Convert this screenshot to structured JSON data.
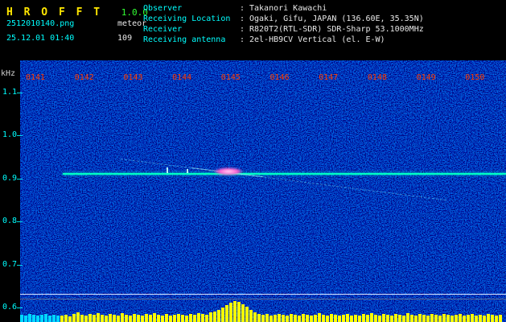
{
  "app": {
    "title": "H R O F F T",
    "version": "1.0.0",
    "filename": "2512010140.png",
    "mode_label": "meteor",
    "timestamp": "25.12.01 01:40",
    "echo_count": "109"
  },
  "station_info": {
    "separator": ":",
    "rows": [
      {
        "label": "Observer",
        "value": "Takanori Kawachi"
      },
      {
        "label": "Receiving Location",
        "value": "Ogaki, Gifu, JAPAN (136.60E, 35.35N)"
      },
      {
        "label": "Receiver",
        "value": "R820T2(RTL-SDR) SDR-Sharp 53.1000MHz"
      },
      {
        "label": "Receiving antenna",
        "value": "2el-HB9CV Vertical (el. E-W)"
      }
    ]
  },
  "spectrogram": {
    "unit_label": "kHz",
    "time_labels": [
      "0141",
      "0142",
      "0143",
      "0144",
      "0145",
      "0146",
      "0147",
      "0148",
      "0149",
      "0150"
    ],
    "freq_labels": [
      "1.1",
      "1.0",
      "0.9",
      "0.8",
      "0.7",
      "0.6"
    ]
  },
  "signal_meter": {
    "cyan_bar_count": 10,
    "bars": [
      9,
      8,
      10,
      9,
      8,
      9,
      10,
      8,
      9,
      8,
      8,
      9,
      7,
      10,
      12,
      9,
      8,
      10,
      9,
      11,
      9,
      8,
      10,
      9,
      8,
      11,
      9,
      8,
      10,
      9,
      8,
      10,
      9,
      11,
      9,
      8,
      10,
      8,
      9,
      10,
      9,
      8,
      10,
      9,
      11,
      10,
      9,
      12,
      13,
      15,
      18,
      21,
      24,
      26,
      25,
      22,
      19,
      15,
      12,
      10,
      9,
      10,
      8,
      9,
      10,
      9,
      8,
      10,
      9,
      8,
      10,
      9,
      8,
      9,
      11,
      9,
      8,
      10,
      9,
      8,
      9,
      10,
      8,
      9,
      8,
      10,
      9,
      11,
      9,
      8,
      10,
      9,
      8,
      10,
      9,
      8,
      11,
      9,
      8,
      10,
      9,
      8,
      10,
      9,
      8,
      10,
      9,
      8,
      9,
      10,
      8,
      9,
      10,
      8,
      9,
      8,
      10,
      9,
      8,
      9
    ]
  },
  "colors": {
    "title": "#ffe600",
    "version": "#33ff33",
    "cyan": "#00ffff",
    "white": "#e8e8e8",
    "time": "#ff3c00",
    "carrier": "#00ffc4",
    "meter": "#ffff00",
    "meter-alt": "#00d8ff",
    "pink": "#ff5fd0"
  }
}
